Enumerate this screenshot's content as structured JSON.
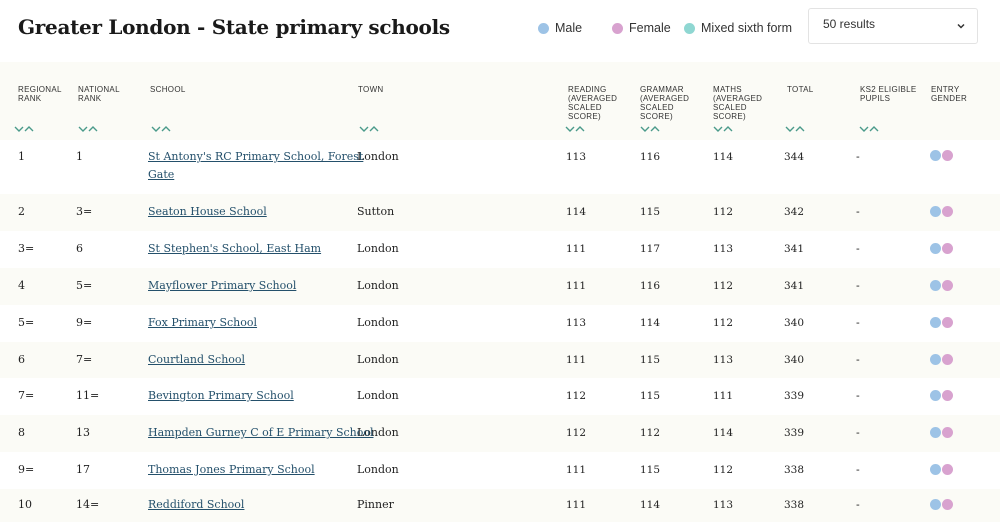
{
  "header": {
    "title": "Greater London - State primary schools",
    "legend": [
      {
        "label": "Male",
        "color": "#9dc3e6"
      },
      {
        "label": "Female",
        "color": "#d8a2cf"
      },
      {
        "label": "Mixed sixth form",
        "color": "#8fd7d2"
      }
    ],
    "results_select": {
      "value": "50 results",
      "icon": "chevron-down-icon"
    }
  },
  "table": {
    "columns": [
      {
        "key": "regional_rank",
        "line1": "REGIONAL",
        "line2": "RANK",
        "line3": "",
        "line4": ""
      },
      {
        "key": "national_rank",
        "line1": "NATIONAL",
        "line2": "RANK",
        "line3": "",
        "line4": ""
      },
      {
        "key": "school",
        "line1": "SCHOOL",
        "line2": "",
        "line3": "",
        "line4": ""
      },
      {
        "key": "town",
        "line1": "TOWN",
        "line2": "",
        "line3": "",
        "line4": ""
      },
      {
        "key": "reading",
        "line1": "READING",
        "line2": "(AVERAGED",
        "line3": "SCALED",
        "line4": "SCORE)"
      },
      {
        "key": "grammar",
        "line1": "GRAMMAR",
        "line2": "(AVERAGED",
        "line3": "SCALED",
        "line4": "SCORE)"
      },
      {
        "key": "maths",
        "line1": "MATHS",
        "line2": "(AVERAGED",
        "line3": "SCALED",
        "line4": "SCORE)"
      },
      {
        "key": "total",
        "line1": "TOTAL",
        "line2": "",
        "line3": "",
        "line4": ""
      },
      {
        "key": "ks2",
        "line1": "KS2 ELIGIBLE",
        "line2": "PUPILS",
        "line3": "",
        "line4": ""
      },
      {
        "key": "entry_gender",
        "line1": "ENTRY",
        "line2": "GENDER",
        "line3": "",
        "line4": ""
      }
    ],
    "rows": [
      {
        "regional": "1",
        "national": "1",
        "school_l1": "St Antony's RC Primary School, Forest",
        "school_l2": "Gate",
        "town": "London",
        "reading": "113",
        "grammar": "116",
        "maths": "114",
        "total": "344",
        "ks2": "-"
      },
      {
        "regional": "2",
        "national": "3=",
        "school_l1": "Seaton House School",
        "school_l2": "",
        "town": "Sutton",
        "reading": "114",
        "grammar": "115",
        "maths": "112",
        "total": "342",
        "ks2": "-"
      },
      {
        "regional": "3=",
        "national": "6",
        "school_l1": "St Stephen's School, East Ham",
        "school_l2": "",
        "town": "London",
        "reading": "111",
        "grammar": "117",
        "maths": "113",
        "total": "341",
        "ks2": "-"
      },
      {
        "regional": "4",
        "national": "5=",
        "school_l1": "Mayflower Primary School",
        "school_l2": "",
        "town": "London",
        "reading": "111",
        "grammar": "116",
        "maths": "112",
        "total": "341",
        "ks2": "-"
      },
      {
        "regional": "5=",
        "national": "9=",
        "school_l1": "Fox Primary School",
        "school_l2": "",
        "town": "London",
        "reading": "113",
        "grammar": "114",
        "maths": "112",
        "total": "340",
        "ks2": "-"
      },
      {
        "regional": "6",
        "national": "7=",
        "school_l1": "Courtland School",
        "school_l2": "",
        "town": "London",
        "reading": "111",
        "grammar": "115",
        "maths": "113",
        "total": "340",
        "ks2": "-"
      },
      {
        "regional": "7=",
        "national": "11=",
        "school_l1": "Bevington Primary School",
        "school_l2": "",
        "town": "London",
        "reading": "112",
        "grammar": "115",
        "maths": "111",
        "total": "339",
        "ks2": "-"
      },
      {
        "regional": "8",
        "national": "13",
        "school_l1": "Hampden Gurney C of E Primary School",
        "school_l2": "",
        "town": "London",
        "reading": "112",
        "grammar": "112",
        "maths": "114",
        "total": "339",
        "ks2": "-"
      },
      {
        "regional": "9=",
        "national": "17",
        "school_l1": "Thomas Jones Primary School",
        "school_l2": "",
        "town": "London",
        "reading": "111",
        "grammar": "115",
        "maths": "112",
        "total": "338",
        "ks2": "-"
      },
      {
        "regional": "10",
        "national": "14=",
        "school_l1": "Reddiford School",
        "school_l2": "",
        "town": "Pinner",
        "reading": "111",
        "grammar": "114",
        "maths": "113",
        "total": "338",
        "ks2": "-"
      }
    ],
    "sort_icon": "sort-chevrons-icon",
    "gender_icon_male": "male-dot-icon",
    "gender_icon_female": "female-dot-icon"
  }
}
